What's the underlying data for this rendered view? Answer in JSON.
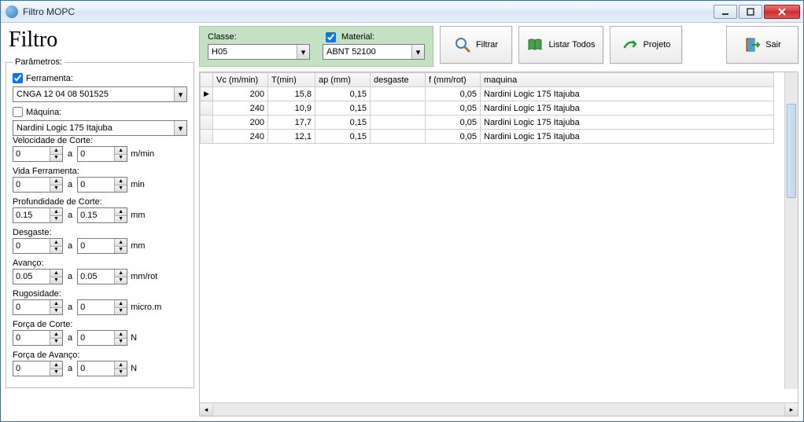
{
  "window": {
    "title": "Filtro MOPC"
  },
  "heading": "Filtro",
  "parametros": {
    "legend": "Parâmetros:",
    "ferramenta_check_label": "Ferramenta:",
    "ferramenta_checked": true,
    "ferramenta_value": "CNGA 12 04 08 501525",
    "maquina_check_label": "Máquina:",
    "maquina_checked": false,
    "maquina_value": "Nardini Logic 175 Itajuba",
    "ranges": [
      {
        "label": "Velocidade de Corte:",
        "from": "0",
        "to": "0",
        "unit": "m/min"
      },
      {
        "label": "Vida Ferramenta:",
        "from": "0",
        "to": "0",
        "unit": "min"
      },
      {
        "label": "Profundidade de Corte:",
        "from": "0.15",
        "to": "0.15",
        "unit": "mm"
      },
      {
        "label": "Desgaste:",
        "from": "0",
        "to": "0",
        "unit": "mm"
      },
      {
        "label": "Avanço:",
        "from": "0.05",
        "to": "0.05",
        "unit": "mm/rot"
      },
      {
        "label": "Rugosidade:",
        "from": "0",
        "to": "0",
        "unit": "micro.m"
      },
      {
        "label": "Força de Corte:",
        "from": "0",
        "to": "0",
        "unit": "N"
      },
      {
        "label": "Força de Avanço:",
        "from": "0",
        "to": "0",
        "unit": "N"
      }
    ],
    "a_label": "a"
  },
  "filters_box": {
    "classe_label": "Classe:",
    "classe_value": "H05",
    "material_label": "Material:",
    "material_checked": true,
    "material_value": "ABNT 52100"
  },
  "actions": {
    "filtrar": "Filtrar",
    "listar": "Listar Todos",
    "projeto": "Projeto",
    "sair": "Sair"
  },
  "grid": {
    "headers": [
      "Vc (m/min)",
      "T(min)",
      "ap (mm)",
      "desgaste",
      "f (mm/rot)",
      "maquina"
    ],
    "rows": [
      {
        "vc": "200",
        "t": "15,8",
        "ap": "0,15",
        "des": "",
        "f": "0,05",
        "maq": "Nardini Logic 175 Itajuba"
      },
      {
        "vc": "240",
        "t": "10,9",
        "ap": "0,15",
        "des": "",
        "f": "0,05",
        "maq": "Nardini Logic 175 Itajuba"
      },
      {
        "vc": "200",
        "t": "17,7",
        "ap": "0,15",
        "des": "",
        "f": "0,05",
        "maq": "Nardini Logic 175 Itajuba"
      },
      {
        "vc": "240",
        "t": "12,1",
        "ap": "0,15",
        "des": "",
        "f": "0,05",
        "maq": "Nardini Logic 175 Itajuba"
      }
    ]
  }
}
